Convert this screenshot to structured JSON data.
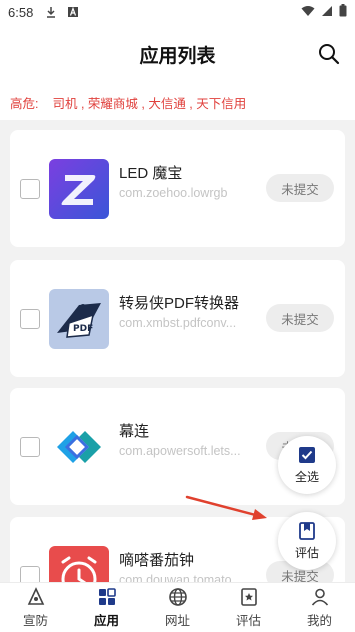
{
  "status_bar": {
    "time": "6:58",
    "icons": [
      "download-icon",
      "notification-a-icon",
      "wifi-icon",
      "signal-icon",
      "battery-icon"
    ]
  },
  "header": {
    "title": "应用列表",
    "search_icon": "search-icon"
  },
  "alert": {
    "label": "高危:",
    "apps": "司机 , 荣耀商城 , 大信通 , 天下信用"
  },
  "apps": [
    {
      "name": "LED 魔宝",
      "package": "com.zoehoo.lowrgb",
      "status": "未提交",
      "icon": "led-mobao-app-icon",
      "icon_color": "#6a4bd6"
    },
    {
      "name": "转易侠PDF转换器",
      "package": "com.xmbst.pdfconv...",
      "status": "未提交",
      "icon": "pdf-converter-app-icon",
      "icon_color": "#b9c9e6"
    },
    {
      "name": "幕连",
      "package": "com.apowersoft.lets...",
      "status": "未提交",
      "icon": "mulian-app-icon",
      "icon_color": "#2a8bd8"
    },
    {
      "name": "嘀嗒番茄钟",
      "package": "com.douwan.tomato...",
      "status": "未提交",
      "icon": "tomato-clock-app-icon",
      "icon_color": "#e84c4c"
    }
  ],
  "fab": {
    "select_all": "全选",
    "evaluate": "评估"
  },
  "tabs": [
    {
      "label": "宣防",
      "icon": "shield-announce-icon"
    },
    {
      "label": "应用",
      "icon": "apps-grid-icon",
      "active": true
    },
    {
      "label": "网址",
      "icon": "globe-icon"
    },
    {
      "label": "评估",
      "icon": "star-doc-icon"
    },
    {
      "label": "我的",
      "icon": "person-icon"
    }
  ],
  "colors": {
    "alert_red": "#e0413d",
    "arrow_red": "#e0412e",
    "tab_active": "#1f3a8a"
  }
}
